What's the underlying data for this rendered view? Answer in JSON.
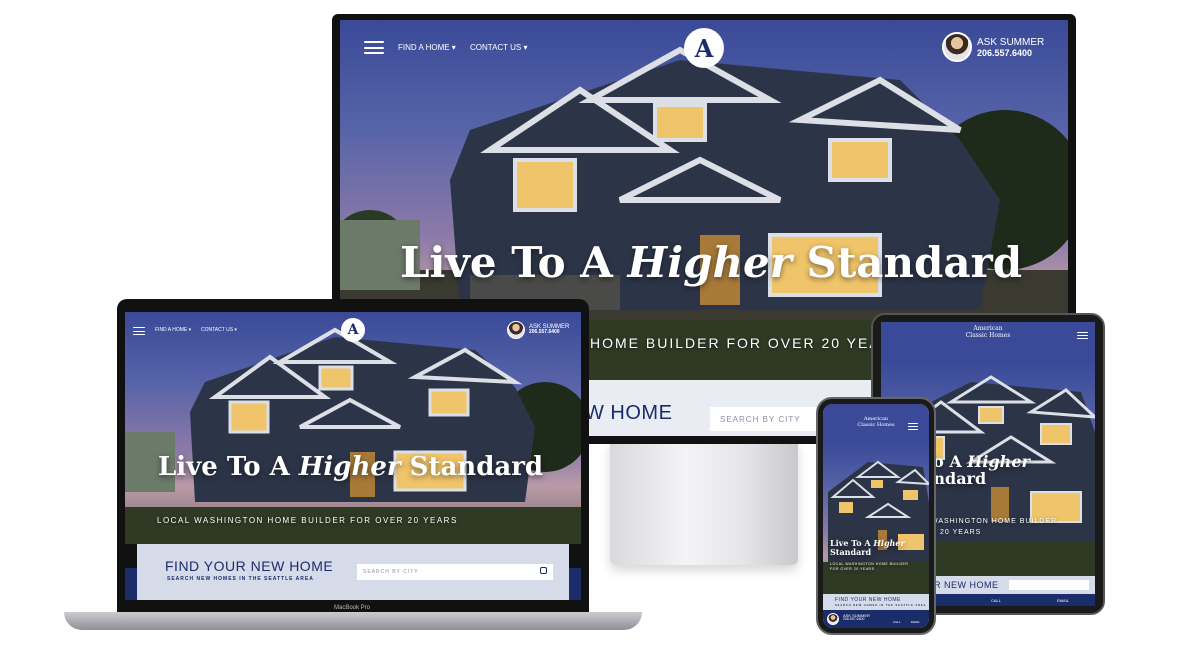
{
  "brand": {
    "primary": "#1b2c6b",
    "light": "#d6dbe9",
    "logo_letter": "A",
    "name_line1": "American",
    "name_line2": "Classic Homes"
  },
  "nav": {
    "find_home": "FIND A HOME ▾",
    "contact_us": "CONTACT US ▾"
  },
  "agent": {
    "ask": "ASK SUMMER",
    "phone": "206.557.6400",
    "laptop_phone": "206.557.6400"
  },
  "hero": {
    "headline_pre": "Live To A ",
    "headline_em": "Higher",
    "headline_post": " Standard",
    "tagline": "LOCAL WASHINGTON HOME BUILDER FOR OVER 20 YEARS",
    "monitor_tagline": "HOME BUILDER FOR OVER 20 YEA",
    "tablet_headline_em_pre": "To A ",
    "tablet_headline_post": "andard",
    "tablet_tagline1": "WASHINGTON HOME BUILDER",
    "tablet_tagline2": "R 20 YEARS",
    "phone_headline1_pre": "Live To A ",
    "phone_headline2": "Standard",
    "phone_tagline1": "LOCAL WASHINGTON HOME BUILDER",
    "phone_tagline2": "FOR OVER 20 YEARS"
  },
  "find": {
    "title": "FIND YOUR NEW HOME",
    "monitor_title": "W HOME",
    "tablet_title": "UR NEW HOME",
    "subtitle": "SEARCH NEW HOMES IN THE SEATTLE AREA",
    "search_placeholder": "SEARCH BY CITY",
    "search_icon": "search-icon"
  },
  "mobile_bar": {
    "call": "CALL",
    "email": "EMAIL",
    "ask": "ASK SUMMER",
    "phone": "206.557.6400"
  },
  "laptop_label": "MacBook Pro"
}
